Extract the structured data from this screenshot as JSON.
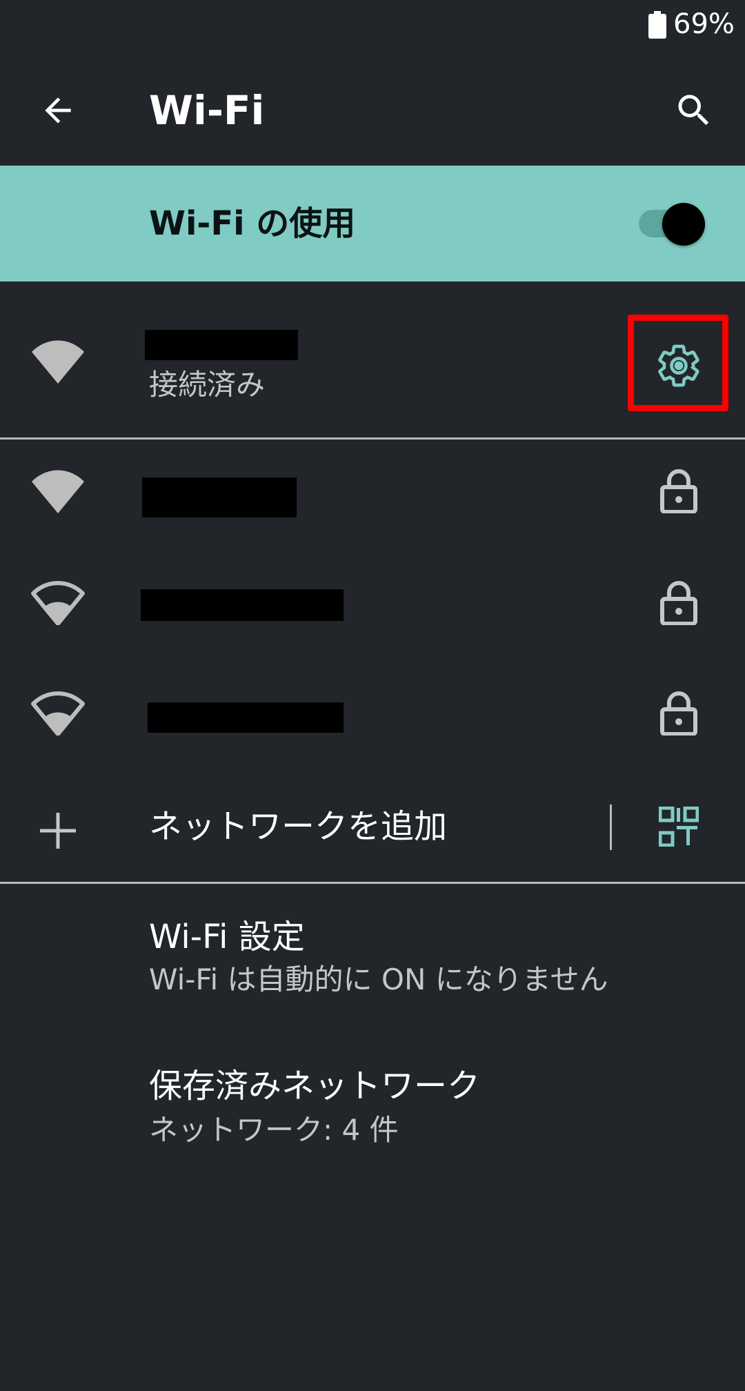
{
  "status_bar": {
    "battery_percent": "69%",
    "battery_icon": "battery-icon"
  },
  "app_bar": {
    "title": "Wi-Fi",
    "back_icon": "arrow-back-icon",
    "search_icon": "search-icon"
  },
  "master_switch": {
    "label": "Wi-Fi の使用",
    "state": "on"
  },
  "connected_network": {
    "ssid": "",
    "status": "接続済み",
    "signal_icon": "wifi-full-icon",
    "settings_icon": "gear-icon",
    "accent_color": "#80cbc4",
    "highlight_color": "#ff0000"
  },
  "networks": [
    {
      "ssid": "",
      "signal_icon": "wifi-full-icon",
      "lock_icon": "lock-icon"
    },
    {
      "ssid": "",
      "signal_icon": "wifi-medium-icon",
      "lock_icon": "lock-icon"
    },
    {
      "ssid": "",
      "signal_icon": "wifi-medium-icon",
      "lock_icon": "lock-icon"
    }
  ],
  "add_network": {
    "label": "ネットワークを追加",
    "add_icon": "plus-icon",
    "qr_icon": "qr-code-scan-icon"
  },
  "wifi_settings": {
    "title": "Wi-Fi 設定",
    "summary": "Wi-Fi は自動的に ON になりません"
  },
  "saved_networks": {
    "title": "保存済みネットワーク",
    "summary": "ネットワーク: 4 件"
  }
}
